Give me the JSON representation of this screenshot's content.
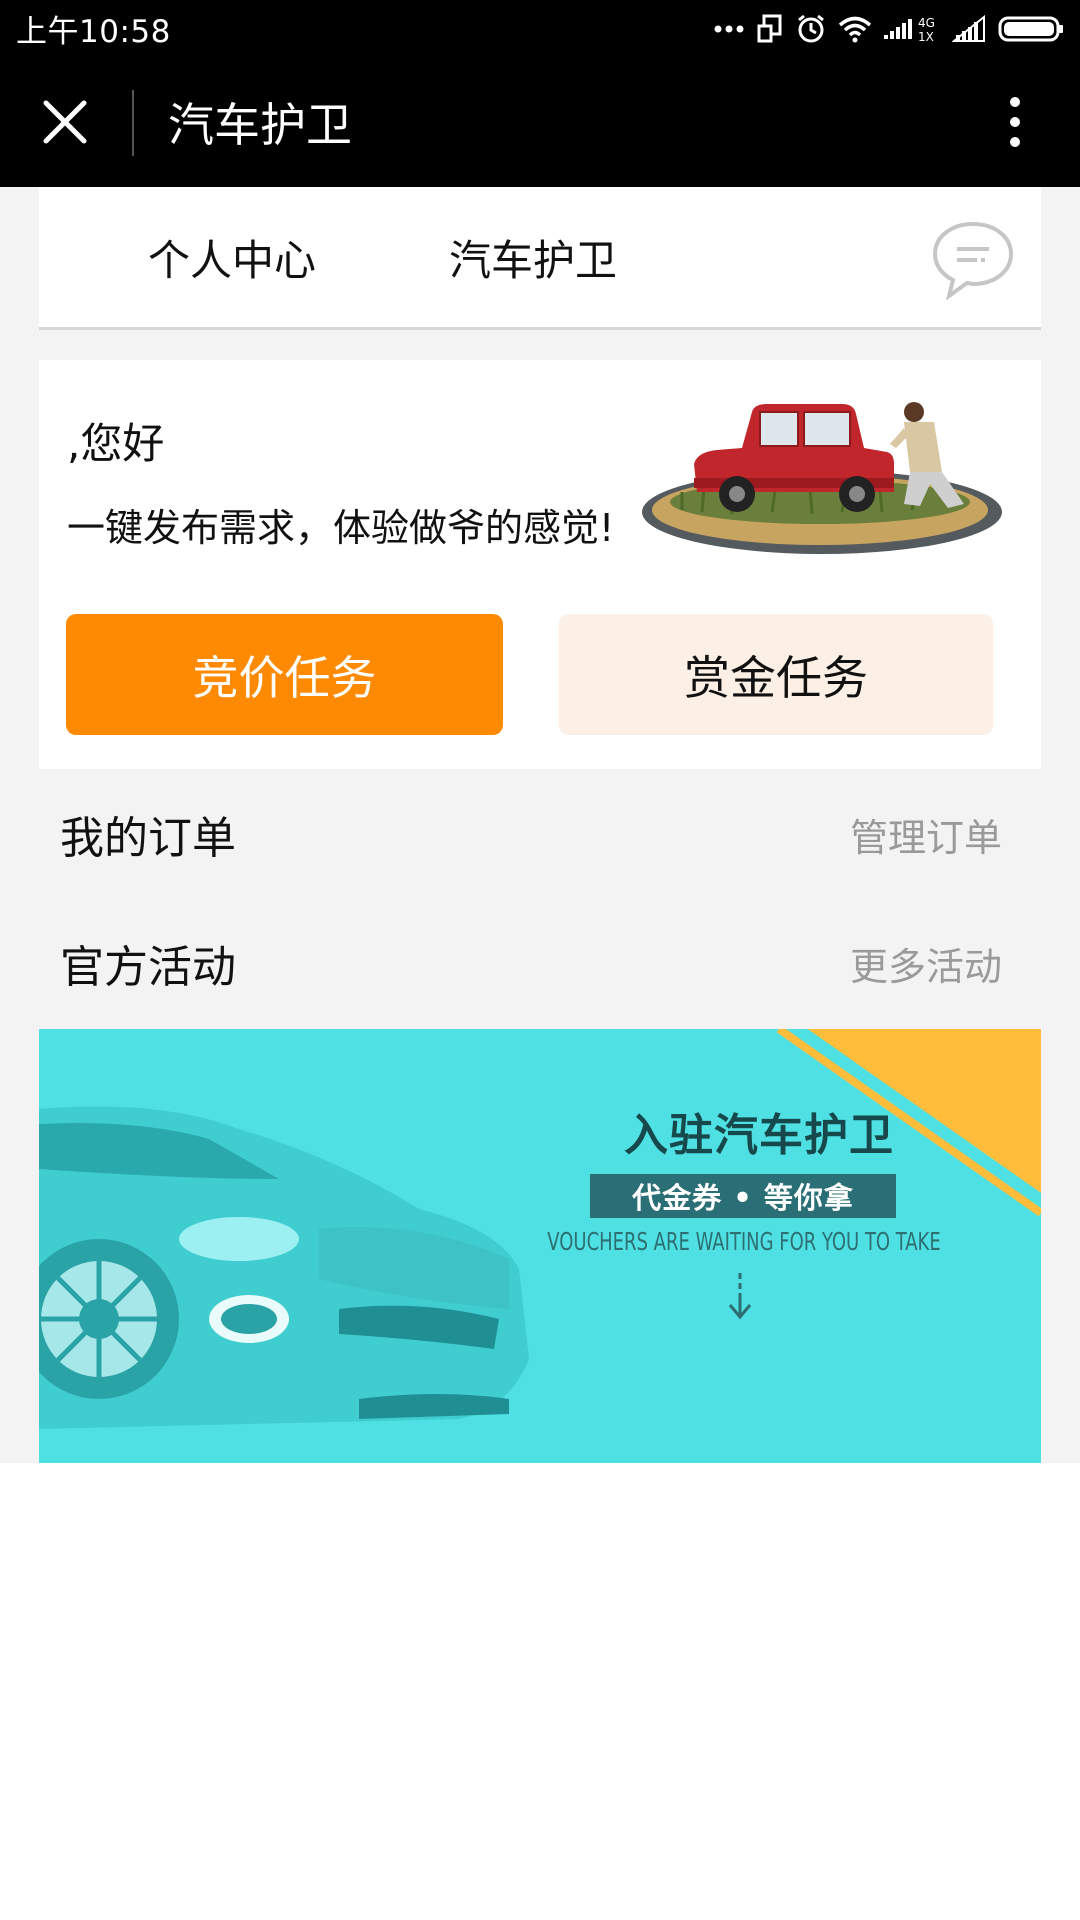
{
  "status_bar": {
    "time": "上午10:58",
    "network_label": "4G",
    "sim_label": "1X"
  },
  "title_bar": {
    "title": "汽车护卫"
  },
  "tabs": [
    {
      "label": "个人中心"
    },
    {
      "label": "汽车护卫"
    }
  ],
  "welcome": {
    "greeting": ",您好",
    "slogan": "一键发布需求，体验做爷的感觉!"
  },
  "actions": {
    "bidding_label": "竞价任务",
    "reward_label": "赏金任务"
  },
  "orders": {
    "title": "我的订单",
    "link": "管理订单"
  },
  "activities": {
    "title": "官方活动",
    "link": "更多活动"
  },
  "banner": {
    "headline": "入驻汽车护卫",
    "voucher": "代金券 • 等你拿",
    "english": "VOUCHERS ARE WAITING FOR YOU TO TAKE"
  },
  "colors": {
    "bidding_button": "#fe8a04",
    "reward_button": "#fcf0e6",
    "banner_bg": "#4fe0e3",
    "banner_stripe": "#ffbd3b"
  }
}
